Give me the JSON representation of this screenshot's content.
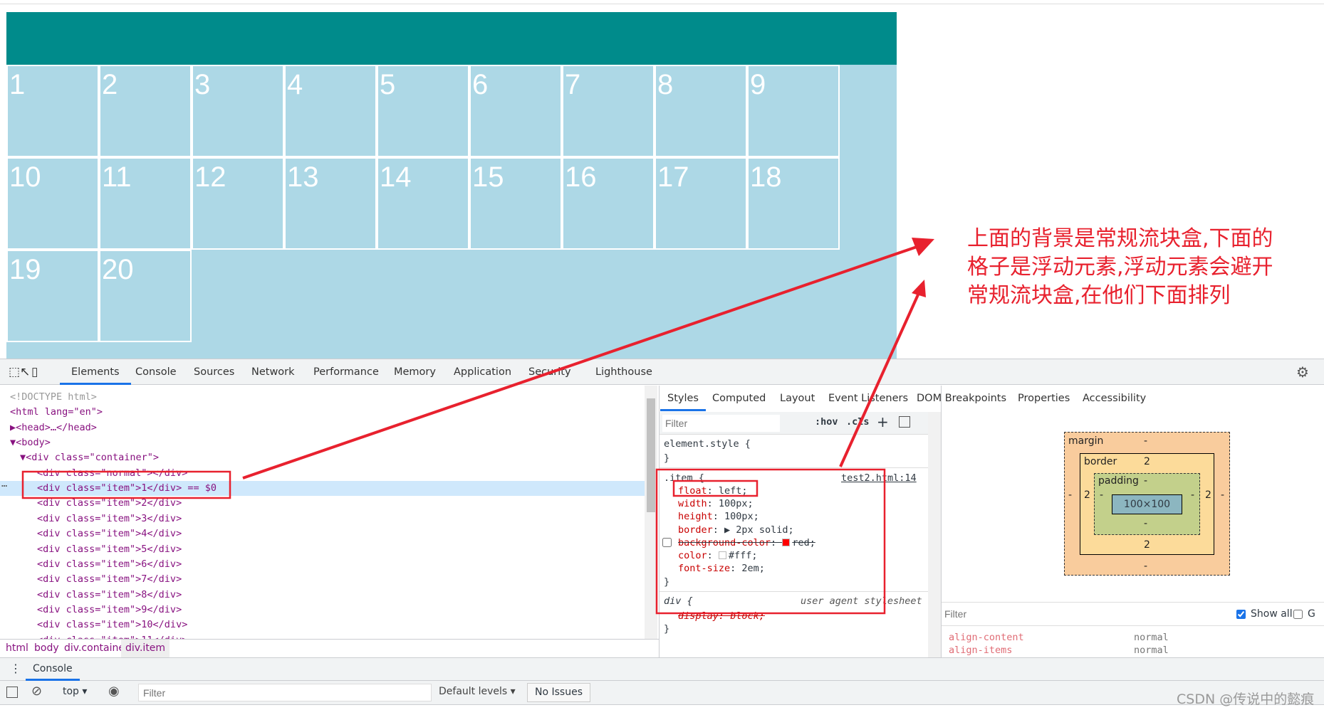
{
  "page": {
    "items": [
      "1",
      "2",
      "3",
      "4",
      "5",
      "6",
      "7",
      "8",
      "9",
      "10",
      "11",
      "12",
      "13",
      "14",
      "15",
      "16",
      "17",
      "18",
      "19",
      "20"
    ],
    "colors": {
      "normal_bg": "#008b8b",
      "container_bg": "#add8e6",
      "annotation": "#e8212e"
    }
  },
  "annotation": {
    "lines": [
      "上面的背景是常规流块盒,下面的",
      "格子是浮动元素,浮动元素会避开",
      "常规流块盒,在他们下面排列"
    ]
  },
  "devtools": {
    "tabs": [
      "Elements",
      "Console",
      "Sources",
      "Network",
      "Performance",
      "Memory",
      "Application",
      "Security",
      "Lighthouse"
    ],
    "active_tab": "Elements",
    "dom_lines": [
      "<!DOCTYPE html>",
      "<html lang=\"en\">",
      "▶<head>…</head>",
      "▼<body>",
      "▼<div class=\"container\">",
      "<div class=\"normal\"></div>",
      "<div class=\"item\">1</div> == $0",
      "<div class=\"item\">2</div>",
      "<div class=\"item\">3</div>",
      "<div class=\"item\">4</div>",
      "<div class=\"item\">5</div>",
      "<div class=\"item\">6</div>",
      "<div class=\"item\">7</div>",
      "<div class=\"item\">8</div>",
      "<div class=\"item\">9</div>",
      "<div class=\"item\">10</div>",
      "<div class=\"item\">11</div>"
    ],
    "breadcrumbs": [
      "html",
      "body",
      "div.container",
      "div.item"
    ],
    "sub_tabs": [
      "Styles",
      "Computed",
      "Layout",
      "Event Listeners",
      "DOM Breakpoints",
      "Properties",
      "Accessibility"
    ],
    "styles": {
      "filter_placeholder": "Filter",
      "hov": ":hov",
      "cls": ".cls",
      "plus": "+",
      "element_style": "element.style {",
      "close": "}",
      "item_selector": ".item {",
      "item_source": "test2.html:14",
      "item_props": [
        {
          "name": "float",
          "value": "left;"
        },
        {
          "name": "width",
          "value": "100px;"
        },
        {
          "name": "height",
          "value": "100px;"
        },
        {
          "name": "border",
          "value": "▶ 2px solid;"
        },
        {
          "name": "background-color",
          "value": "red;",
          "struck": true,
          "swatch": "#ff0000"
        },
        {
          "name": "color",
          "value": "#fff;",
          "swatch": "#ffffff"
        },
        {
          "name": "font-size",
          "value": "2em;"
        }
      ],
      "div_selector": "div {",
      "div_source": "user agent stylesheet",
      "div_prop": "display: block;"
    },
    "box_model": {
      "margin_label": "margin",
      "margin": "-",
      "border_label": "border",
      "border": "2",
      "padding_label": "padding",
      "padding": "-",
      "content": "100×100"
    },
    "computed": {
      "filter_placeholder": "Filter",
      "show_all": "Show all",
      "show_all_checked": true,
      "group_label": "G",
      "rows": [
        {
          "name": "align-content",
          "value": "normal"
        },
        {
          "name": "align-items",
          "value": "normal"
        }
      ]
    },
    "console": {
      "drawer_tab": "Console",
      "context": "top",
      "filter_placeholder": "Filter",
      "levels": "Default levels",
      "issues": "No Issues"
    }
  },
  "watermark": "CSDN @传说中的懿痕"
}
